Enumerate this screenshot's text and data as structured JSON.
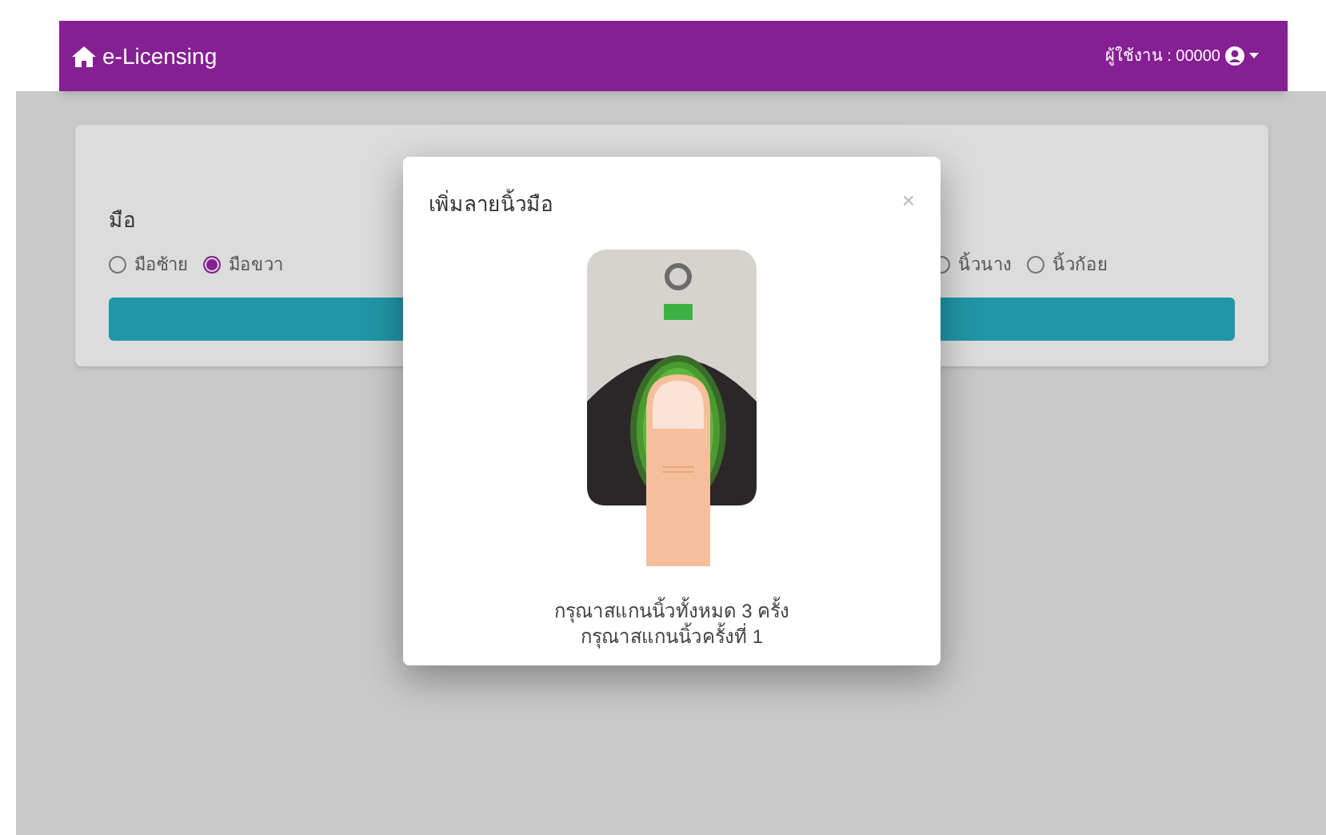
{
  "navbar": {
    "brand": "e-Licensing",
    "user_label": "ผู้ใช้งาน : 00000"
  },
  "form": {
    "hand_label": "มือ",
    "hand_options": [
      {
        "label": "มือซ้าย",
        "selected": false
      },
      {
        "label": "มือขวา",
        "selected": true
      }
    ],
    "finger_options": [
      {
        "label": "นิ้วนาง",
        "selected": false
      },
      {
        "label": "นิ้วก้อย",
        "selected": false
      }
    ]
  },
  "modal": {
    "title": "เพิ่มลายนิ้วมือ",
    "close": "×",
    "messages": [
      "กรุณาสแกนนิ้วทั้งหมด 3 ครั้ง",
      "กรุณาสแกนนิ้วครั้งที่ 1"
    ]
  }
}
